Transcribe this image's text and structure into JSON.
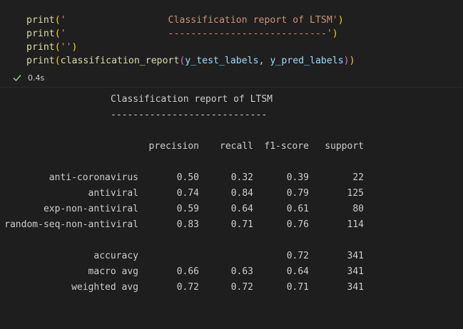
{
  "code": {
    "line1": {
      "fn": "print",
      "str": "'                  Classification report of LTSM'"
    },
    "line2": {
      "fn": "print",
      "str": "'                  ----------------------------'"
    },
    "line3": {
      "fn": "print",
      "str": "''"
    },
    "line4": {
      "fn1": "print",
      "fn2": "classification_report",
      "arg1": "y_test_labels",
      "sep": ", ",
      "arg2": "y_pred_labels"
    }
  },
  "status": {
    "icon": "check-icon",
    "duration": "0.4s",
    "color": "#89d185"
  },
  "output": {
    "title": "Classification report of LTSM",
    "underline": "----------------------------",
    "headers": [
      "precision",
      "recall",
      "f1-score",
      "support"
    ],
    "rows": [
      {
        "label": "anti-coronavirus",
        "precision": "0.50",
        "recall": "0.32",
        "f1": "0.39",
        "support": "22"
      },
      {
        "label": "antiviral",
        "precision": "0.74",
        "recall": "0.84",
        "f1": "0.79",
        "support": "125"
      },
      {
        "label": "exp-non-antiviral",
        "precision": "0.59",
        "recall": "0.64",
        "f1": "0.61",
        "support": "80"
      },
      {
        "label": "random-seq-non-antiviral",
        "precision": "0.83",
        "recall": "0.71",
        "f1": "0.76",
        "support": "114"
      }
    ],
    "summary": [
      {
        "label": "accuracy",
        "precision": "",
        "recall": "",
        "f1": "0.72",
        "support": "341"
      },
      {
        "label": "macro avg",
        "precision": "0.66",
        "recall": "0.63",
        "f1": "0.64",
        "support": "341"
      },
      {
        "label": "weighted avg",
        "precision": "0.72",
        "recall": "0.72",
        "f1": "0.71",
        "support": "341"
      }
    ]
  }
}
